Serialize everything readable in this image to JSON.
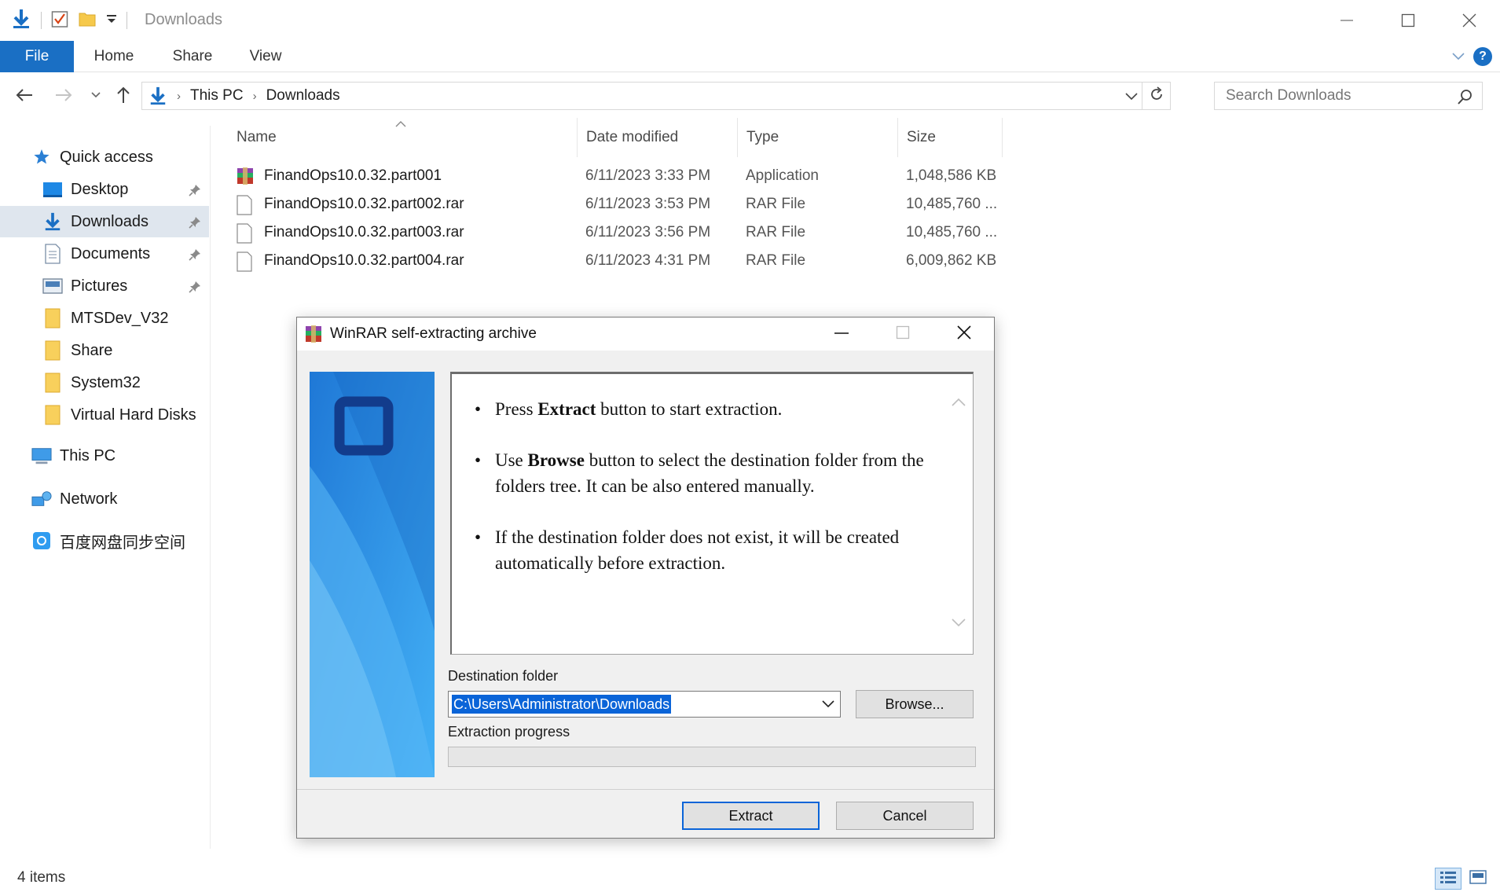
{
  "window": {
    "title": "Downloads"
  },
  "ribbon": {
    "tabs": [
      "File",
      "Home",
      "Share",
      "View"
    ]
  },
  "address": {
    "crumbs": [
      "This PC",
      "Downloads"
    ]
  },
  "search": {
    "placeholder": "Search Downloads"
  },
  "sidebar": {
    "items": [
      {
        "label": "Quick access",
        "icon": "star-icon"
      },
      {
        "label": "Desktop",
        "icon": "desktop-icon",
        "pinned": true
      },
      {
        "label": "Downloads",
        "icon": "download-arrow-icon",
        "pinned": true,
        "selected": true
      },
      {
        "label": "Documents",
        "icon": "documents-icon",
        "pinned": true
      },
      {
        "label": "Pictures",
        "icon": "pictures-icon",
        "pinned": true
      },
      {
        "label": "MTSDev_V32",
        "icon": "folder-icon"
      },
      {
        "label": "Share",
        "icon": "folder-icon"
      },
      {
        "label": "System32",
        "icon": "folder-icon"
      },
      {
        "label": "Virtual Hard Disks",
        "icon": "folder-icon"
      },
      {
        "label": "This PC",
        "icon": "computer-icon"
      },
      {
        "label": "Network",
        "icon": "network-icon"
      },
      {
        "label": "百度网盘同步空间",
        "icon": "baidu-sync-icon"
      }
    ]
  },
  "filelist": {
    "columns": [
      "Name",
      "Date modified",
      "Type",
      "Size"
    ],
    "rows": [
      {
        "name": "FinandOps10.0.32.part001",
        "date": "6/11/2023 3:33 PM",
        "type": "Application",
        "size": "1,048,586 KB",
        "icon": "winrar-app-icon"
      },
      {
        "name": "FinandOps10.0.32.part002.rar",
        "date": "6/11/2023 3:53 PM",
        "type": "RAR File",
        "size": "10,485,760 ...",
        "icon": "file-icon"
      },
      {
        "name": "FinandOps10.0.32.part003.rar",
        "date": "6/11/2023 3:56 PM",
        "type": "RAR File",
        "size": "10,485,760 ...",
        "icon": "file-icon"
      },
      {
        "name": "FinandOps10.0.32.part004.rar",
        "date": "6/11/2023 4:31 PM",
        "type": "RAR File",
        "size": "6,009,862 KB",
        "icon": "file-icon"
      }
    ]
  },
  "status": {
    "item_count": "4 items"
  },
  "dialog": {
    "title": "WinRAR self-extracting archive",
    "info": {
      "b1_pre": "Press ",
      "b1_bold": "Extract",
      "b1_post": " button to start extraction.",
      "b2_pre": "Use ",
      "b2_bold": "Browse",
      "b2_post": " button to select the destination folder from the folders tree. It can be also entered manually.",
      "b3": "If the destination folder does not exist, it will be created automatically before extraction."
    },
    "destination_label": "Destination folder",
    "destination_value": "C:\\Users\\Administrator\\Downloads",
    "browse_label": "Browse...",
    "progress_label": "Extraction progress",
    "progress_value": 0,
    "extract_label": "Extract",
    "cancel_label": "Cancel"
  },
  "colors": {
    "accent": "#1a6fc4",
    "selection": "#0a64d8",
    "sidebar_selected": "#dfe6ee"
  }
}
